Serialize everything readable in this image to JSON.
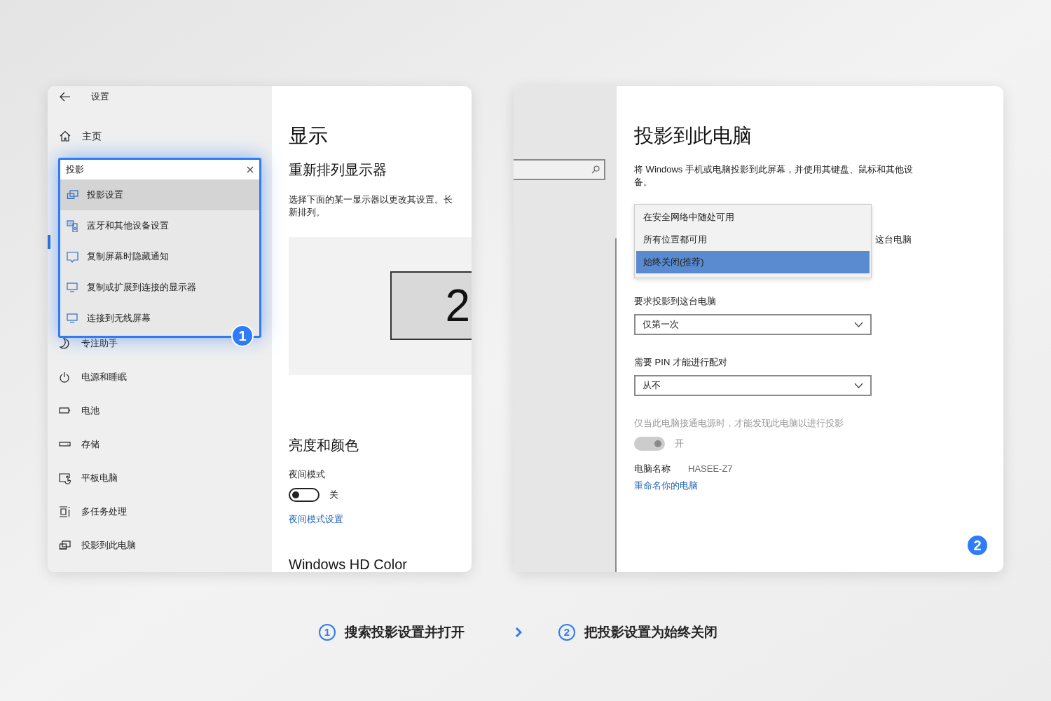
{
  "settings_window": {
    "title": "设置",
    "home": "主页",
    "search": {
      "value": "投影"
    },
    "suggestions": [
      {
        "label": "投影设置",
        "selected": true
      },
      {
        "label": "蓝牙和其他设备设置",
        "selected": false
      },
      {
        "label": "复制屏幕时隐藏通知",
        "selected": false
      },
      {
        "label": "复制或扩展到连接的显示器",
        "selected": false
      },
      {
        "label": "连接到无线屏幕",
        "selected": false
      }
    ],
    "nav_items": [
      {
        "label": "专注助手"
      },
      {
        "label": "电源和睡眠"
      },
      {
        "label": "电池"
      },
      {
        "label": "存储"
      },
      {
        "label": "平板电脑"
      },
      {
        "label": "多任务处理"
      },
      {
        "label": "投影到此电脑"
      }
    ],
    "step_badge": "1",
    "page": {
      "title": "显示",
      "section": "重新排列显示器",
      "description_lines": [
        "选择下面的某一显示器以更改其设置。长",
        "新排列。"
      ],
      "monitor_label": "2",
      "section_2": "亮度和颜色",
      "night_light": {
        "label": "夜间模式",
        "on": false,
        "disabled": false,
        "state_text": "关"
      },
      "night_light_link": "夜间模式设置",
      "section_3": "Windows HD Color"
    }
  },
  "projection_window": {
    "title": "投影到此电脑",
    "description_lines": [
      "将 Windows 手机或电脑投影到此屏幕，并使用其键盘、鼠标和其他设",
      "备。"
    ],
    "partial_label": "这台电脑",
    "dropdown_options": [
      {
        "label": "在安全网络中随处可用",
        "selected": false
      },
      {
        "label": "所有位置都可用",
        "selected": false
      },
      {
        "label": "始终关闭(推荐)",
        "selected": true
      }
    ],
    "ask_label": "要求投影到这台电脑",
    "ask_value": "仅第一次",
    "pin_label": "需要 PIN 才能进行配对",
    "pin_value": "从不",
    "power_label": "仅当此电脑接通电源时，才能发现此电脑以进行投影",
    "power_toggle": {
      "on": true,
      "disabled": true,
      "state_text": "开"
    },
    "pc_name_label": "电脑名称",
    "pc_name": "HASEE-Z7",
    "rename_link": "重命名你的电脑",
    "step_badge": "2"
  },
  "steps": [
    {
      "number": "1",
      "text": "搜索投影设置并打开"
    },
    {
      "number": "2",
      "text": "把投影设置为始终关闭"
    }
  ]
}
